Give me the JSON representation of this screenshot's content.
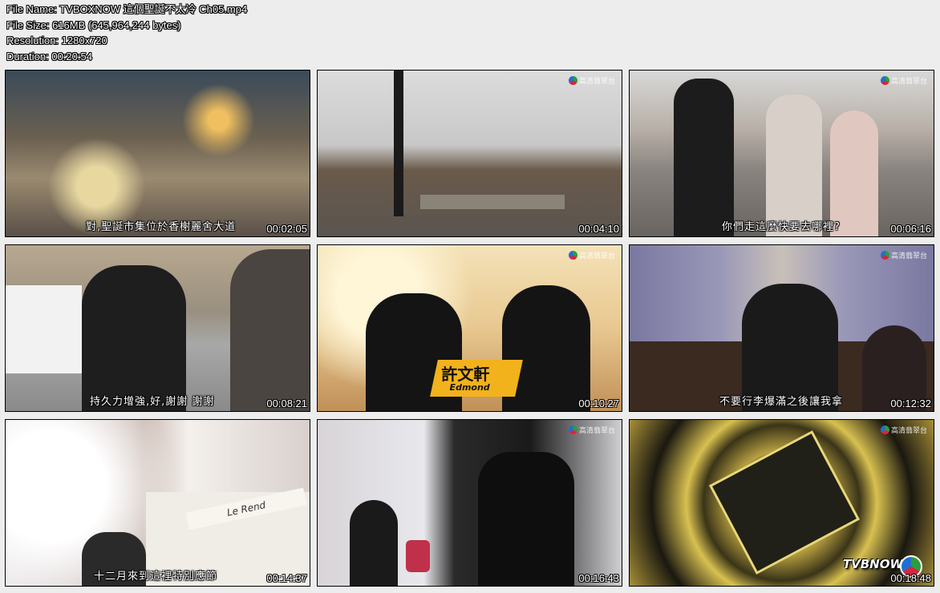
{
  "header": {
    "file_name": "File Name: TVBOXNOW 這個聖誕不太冷 Ch05.mp4",
    "file_size": "File Size: 616MB (645,964,244 bytes)",
    "resolution": "Resolution: 1280x720",
    "duration": "Duration: 00:20:54"
  },
  "thumbnails": [
    {
      "time": "00:02:05",
      "subtitle": "對,聖誕市集位於香榭麗舍大道",
      "logo": ""
    },
    {
      "time": "00:04:10",
      "subtitle": "",
      "logo": "高清翡翠台"
    },
    {
      "time": "00:06:16",
      "subtitle": "你們走這麼快要去哪裡?",
      "logo": "高清翡翠台"
    },
    {
      "time": "00:08:21",
      "subtitle": "持久力增強,好,謝謝     謝謝",
      "logo": ""
    },
    {
      "time": "00:10:27",
      "subtitle": "",
      "logo": "高清翡翠台",
      "name_cn": "許文軒",
      "name_en": "Edmond"
    },
    {
      "time": "00:12:32",
      "subtitle": "不要行李爆滿之後讓我拿",
      "logo": "高清翡翠台"
    },
    {
      "time": "00:14:37",
      "subtitle": "十二月來到這裡特別應節",
      "logo": "",
      "sign": "Le Rend"
    },
    {
      "time": "00:16:43",
      "subtitle": "",
      "logo": "高清翡翠台"
    },
    {
      "time": "00:18:48",
      "subtitle": "",
      "logo": "高清翡翠台",
      "watermark": "TVBNOW"
    }
  ]
}
